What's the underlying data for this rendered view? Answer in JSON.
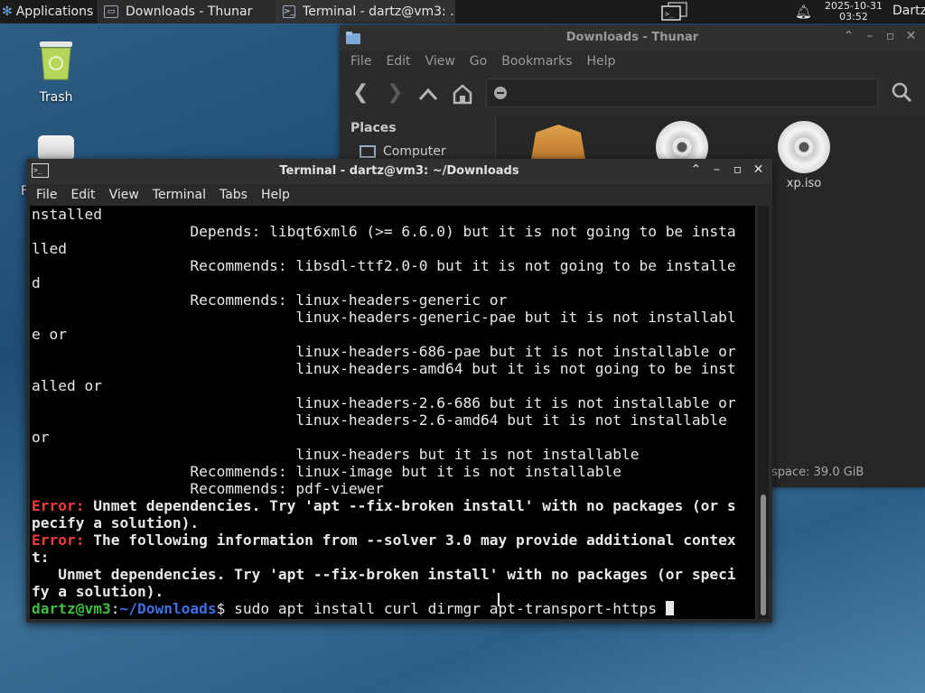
{
  "panel": {
    "applications_label": "Applications",
    "tasks": [
      {
        "label": "Downloads - Thunar"
      },
      {
        "label": "Terminal - dartz@vm3: ..."
      }
    ],
    "clock_date": "2025-10-31",
    "clock_time": "03:52",
    "user": "Dartz"
  },
  "desktop": {
    "icons": [
      {
        "label": "Trash",
        "icon": "trash-icon"
      },
      {
        "label": "F",
        "icon": "drive-icon"
      }
    ]
  },
  "thunar": {
    "title": "Downloads - Thunar",
    "menu": [
      "File",
      "Edit",
      "View",
      "Go",
      "Bookmarks",
      "Help"
    ],
    "sidebar": {
      "heading": "Places",
      "items": [
        {
          "label": "Computer",
          "icon": "computer-icon"
        }
      ]
    },
    "files": [
      {
        "label": "",
        "icon": "package-icon"
      },
      {
        "label": "",
        "icon": "disc-icon"
      },
      {
        "label": "xp.iso",
        "icon": "disc-icon"
      }
    ],
    "status": "space: 39.0 GiB"
  },
  "terminal": {
    "title": "Terminal - dartz@vm3: ~/Downloads",
    "menu": [
      "File",
      "Edit",
      "View",
      "Terminal",
      "Tabs",
      "Help"
    ],
    "lines": [
      "nstalled",
      "                  Depends: libqt6xml6 (>= 6.6.0) but it is not going to be insta",
      "lled",
      "                  Recommends: libsdl-ttf2.0-0 but it is not going to be installe",
      "d",
      "                  Recommends: linux-headers-generic or",
      "                              linux-headers-generic-pae but it is not installabl",
      "e or",
      "                              linux-headers-686-pae but it is not installable or",
      "                              linux-headers-amd64 but it is not going to be inst",
      "alled or",
      "                              linux-headers-2.6-686 but it is not installable or",
      "                              linux-headers-2.6-amd64 but it is not installable",
      "or",
      "                              linux-headers but it is not installable",
      "                  Recommends: linux-image but it is not installable",
      "                  Recommends: pdf-viewer"
    ],
    "error_label": "Error:",
    "error1_a": " Unmet dependencies. Try 'apt --fix-broken install' with no packages (or s",
    "error1_b": "pecify a solution).",
    "error2_a": " The following information from --solver 3.0 may provide additional contex",
    "error2_b": "t:",
    "info_a": "   Unmet dependencies. Try 'apt --fix-broken install' with no packages (or speci",
    "info_b": "fy a solution).",
    "prompt_user": "dartz@vm3",
    "prompt_sep": ":",
    "prompt_path": "~/Downloads",
    "prompt_dollar": "$",
    "command": " sudo apt install curl dirmgr apt-transport-https "
  }
}
